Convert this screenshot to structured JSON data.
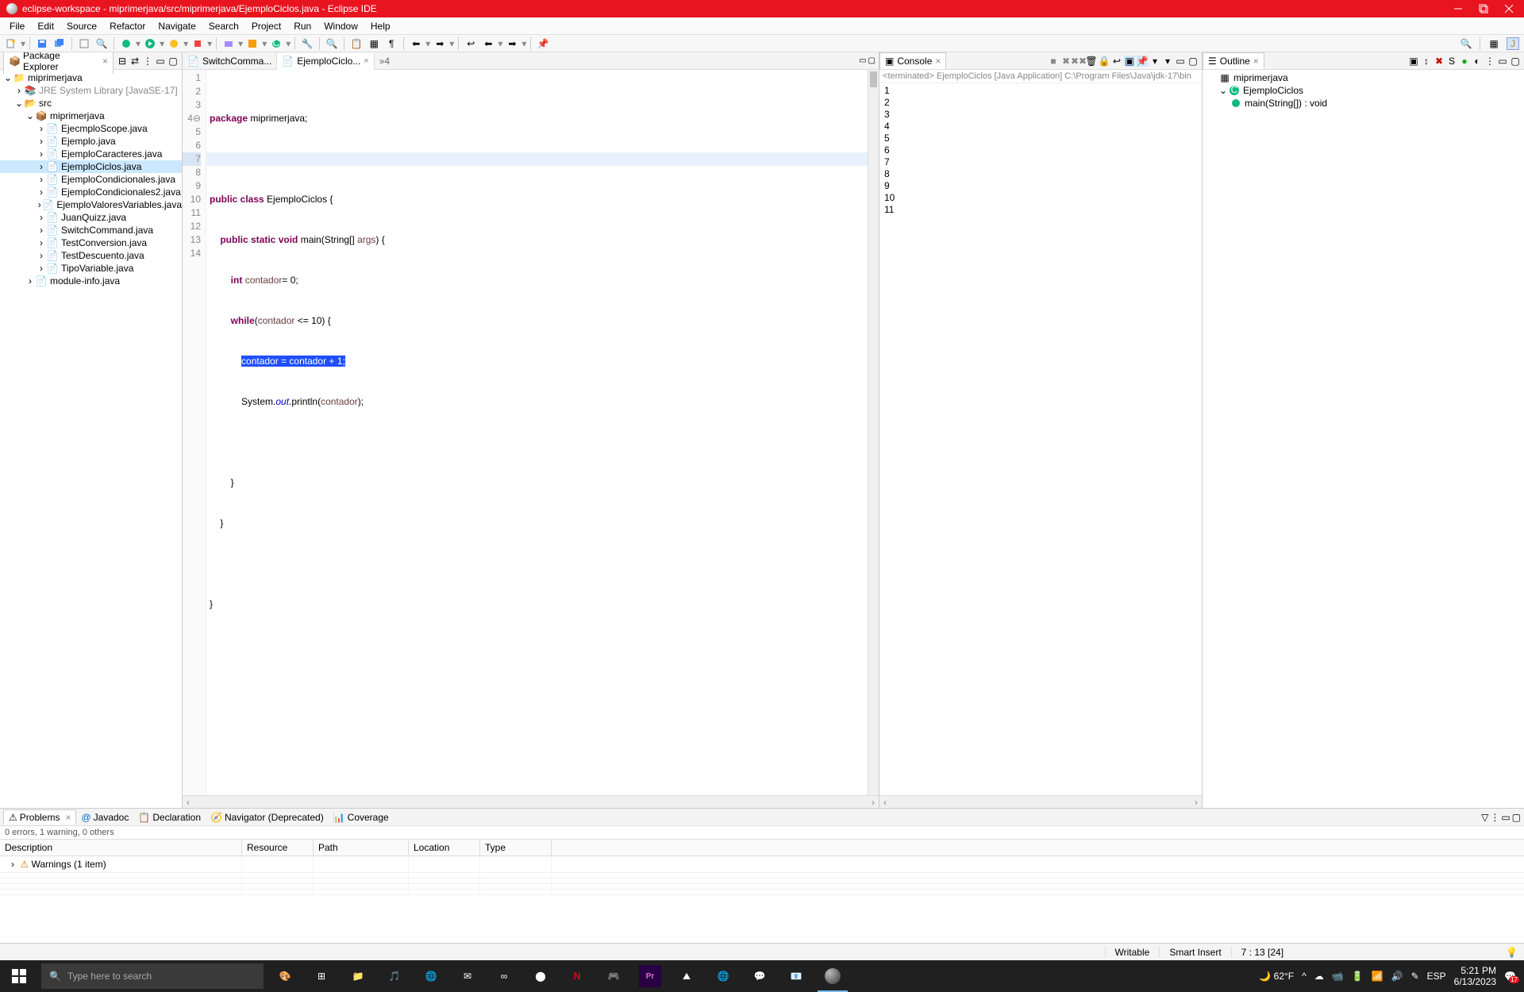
{
  "titlebar": {
    "title": "eclipse-workspace - miprimerjava/src/miprimerjava/EjemploCiclos.java - Eclipse IDE"
  },
  "menu": [
    "File",
    "Edit",
    "Source",
    "Refactor",
    "Navigate",
    "Search",
    "Project",
    "Run",
    "Window",
    "Help"
  ],
  "packageExplorer": {
    "title": "Package Explorer",
    "project": "miprimerjava",
    "jre": "JRE System Library [JavaSE-17]",
    "srcFolder": "src",
    "package": "miprimerjava",
    "files": [
      "EjecmploScope.java",
      "Ejemplo.java",
      "EjemploCaracteres.java",
      "EjemploCiclos.java",
      "EjemploCondicionales.java",
      "EjemploCondicionales2.java",
      "EjemploValoresVariables.java",
      "JuanQuizz.java",
      "SwitchCommand.java",
      "TestConversion.java",
      "TestDescuento.java",
      "TipoVariable.java"
    ],
    "moduleInfo": "module-info.java"
  },
  "editor": {
    "tabs": [
      {
        "label": "SwitchComma...",
        "active": false
      },
      {
        "label": "EjemploCiclo...",
        "active": true
      }
    ],
    "overflow": "»4",
    "lines": [
      {
        "n": 1,
        "text": "package miprimerjava;"
      },
      {
        "n": 2,
        "text": ""
      },
      {
        "n": 3,
        "text": "public class EjemploCiclos {"
      },
      {
        "n": 4,
        "text": "    public static void main(String[] args) {"
      },
      {
        "n": 5,
        "text": "        int contador= 0;"
      },
      {
        "n": 6,
        "text": "        while(contador <= 10) {"
      },
      {
        "n": 7,
        "selected": "contador = contador + 1;"
      },
      {
        "n": 8,
        "text": "            System.out.println(contador);"
      },
      {
        "n": 9,
        "text": "        "
      },
      {
        "n": 10,
        "text": "        }"
      },
      {
        "n": 11,
        "text": "    }"
      },
      {
        "n": 12,
        "text": ""
      },
      {
        "n": 13,
        "text": "}"
      },
      {
        "n": 14,
        "text": ""
      }
    ]
  },
  "console": {
    "title": "Console",
    "status": "<terminated> EjemploCiclos [Java Application] C:\\Program Files\\Java\\jdk-17\\bin",
    "output": [
      "1",
      "2",
      "3",
      "4",
      "5",
      "6",
      "7",
      "8",
      "9",
      "10",
      "11"
    ]
  },
  "outline": {
    "title": "Outline",
    "package": "miprimerjava",
    "class": "EjemploCiclos",
    "method": "main(String[]) : void"
  },
  "problems": {
    "tabs": [
      "Problems",
      "Javadoc",
      "Declaration",
      "Navigator (Deprecated)",
      "Coverage"
    ],
    "status": "0 errors, 1 warning, 0 others",
    "columns": [
      "Description",
      "Resource",
      "Path",
      "Location",
      "Type"
    ],
    "warnings": "Warnings (1 item)"
  },
  "statusbar": {
    "writable": "Writable",
    "insert": "Smart Insert",
    "position": "7 : 13 [24]"
  },
  "taskbar": {
    "search_placeholder": "Type here to search",
    "temp": "62°F",
    "lang": "ESP",
    "time": "5:21 PM",
    "date": "6/13/2023",
    "notif": "17"
  }
}
